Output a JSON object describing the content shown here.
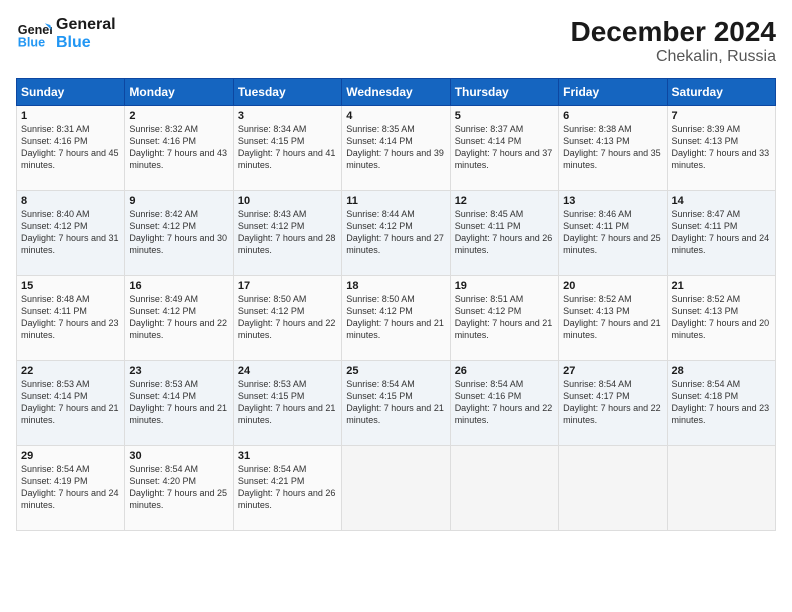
{
  "logo": {
    "line1": "General",
    "line2": "Blue"
  },
  "title": "December 2024",
  "subtitle": "Chekalin, Russia",
  "days_header": [
    "Sunday",
    "Monday",
    "Tuesday",
    "Wednesday",
    "Thursday",
    "Friday",
    "Saturday"
  ],
  "weeks": [
    [
      {
        "day": "1",
        "sunrise": "8:31 AM",
        "sunset": "4:16 PM",
        "daylight": "7 hours and 45 minutes."
      },
      {
        "day": "2",
        "sunrise": "8:32 AM",
        "sunset": "4:16 PM",
        "daylight": "7 hours and 43 minutes."
      },
      {
        "day": "3",
        "sunrise": "8:34 AM",
        "sunset": "4:15 PM",
        "daylight": "7 hours and 41 minutes."
      },
      {
        "day": "4",
        "sunrise": "8:35 AM",
        "sunset": "4:14 PM",
        "daylight": "7 hours and 39 minutes."
      },
      {
        "day": "5",
        "sunrise": "8:37 AM",
        "sunset": "4:14 PM",
        "daylight": "7 hours and 37 minutes."
      },
      {
        "day": "6",
        "sunrise": "8:38 AM",
        "sunset": "4:13 PM",
        "daylight": "7 hours and 35 minutes."
      },
      {
        "day": "7",
        "sunrise": "8:39 AM",
        "sunset": "4:13 PM",
        "daylight": "7 hours and 33 minutes."
      }
    ],
    [
      {
        "day": "8",
        "sunrise": "8:40 AM",
        "sunset": "4:12 PM",
        "daylight": "7 hours and 31 minutes."
      },
      {
        "day": "9",
        "sunrise": "8:42 AM",
        "sunset": "4:12 PM",
        "daylight": "7 hours and 30 minutes."
      },
      {
        "day": "10",
        "sunrise": "8:43 AM",
        "sunset": "4:12 PM",
        "daylight": "7 hours and 28 minutes."
      },
      {
        "day": "11",
        "sunrise": "8:44 AM",
        "sunset": "4:12 PM",
        "daylight": "7 hours and 27 minutes."
      },
      {
        "day": "12",
        "sunrise": "8:45 AM",
        "sunset": "4:11 PM",
        "daylight": "7 hours and 26 minutes."
      },
      {
        "day": "13",
        "sunrise": "8:46 AM",
        "sunset": "4:11 PM",
        "daylight": "7 hours and 25 minutes."
      },
      {
        "day": "14",
        "sunrise": "8:47 AM",
        "sunset": "4:11 PM",
        "daylight": "7 hours and 24 minutes."
      }
    ],
    [
      {
        "day": "15",
        "sunrise": "8:48 AM",
        "sunset": "4:11 PM",
        "daylight": "7 hours and 23 minutes."
      },
      {
        "day": "16",
        "sunrise": "8:49 AM",
        "sunset": "4:12 PM",
        "daylight": "7 hours and 22 minutes."
      },
      {
        "day": "17",
        "sunrise": "8:50 AM",
        "sunset": "4:12 PM",
        "daylight": "7 hours and 22 minutes."
      },
      {
        "day": "18",
        "sunrise": "8:50 AM",
        "sunset": "4:12 PM",
        "daylight": "7 hours and 21 minutes."
      },
      {
        "day": "19",
        "sunrise": "8:51 AM",
        "sunset": "4:12 PM",
        "daylight": "7 hours and 21 minutes."
      },
      {
        "day": "20",
        "sunrise": "8:52 AM",
        "sunset": "4:13 PM",
        "daylight": "7 hours and 21 minutes."
      },
      {
        "day": "21",
        "sunrise": "8:52 AM",
        "sunset": "4:13 PM",
        "daylight": "7 hours and 20 minutes."
      }
    ],
    [
      {
        "day": "22",
        "sunrise": "8:53 AM",
        "sunset": "4:14 PM",
        "daylight": "7 hours and 21 minutes."
      },
      {
        "day": "23",
        "sunrise": "8:53 AM",
        "sunset": "4:14 PM",
        "daylight": "7 hours and 21 minutes."
      },
      {
        "day": "24",
        "sunrise": "8:53 AM",
        "sunset": "4:15 PM",
        "daylight": "7 hours and 21 minutes."
      },
      {
        "day": "25",
        "sunrise": "8:54 AM",
        "sunset": "4:15 PM",
        "daylight": "7 hours and 21 minutes."
      },
      {
        "day": "26",
        "sunrise": "8:54 AM",
        "sunset": "4:16 PM",
        "daylight": "7 hours and 22 minutes."
      },
      {
        "day": "27",
        "sunrise": "8:54 AM",
        "sunset": "4:17 PM",
        "daylight": "7 hours and 22 minutes."
      },
      {
        "day": "28",
        "sunrise": "8:54 AM",
        "sunset": "4:18 PM",
        "daylight": "7 hours and 23 minutes."
      }
    ],
    [
      {
        "day": "29",
        "sunrise": "8:54 AM",
        "sunset": "4:19 PM",
        "daylight": "7 hours and 24 minutes."
      },
      {
        "day": "30",
        "sunrise": "8:54 AM",
        "sunset": "4:20 PM",
        "daylight": "7 hours and 25 minutes."
      },
      {
        "day": "31",
        "sunrise": "8:54 AM",
        "sunset": "4:21 PM",
        "daylight": "7 hours and 26 minutes."
      },
      null,
      null,
      null,
      null
    ]
  ]
}
